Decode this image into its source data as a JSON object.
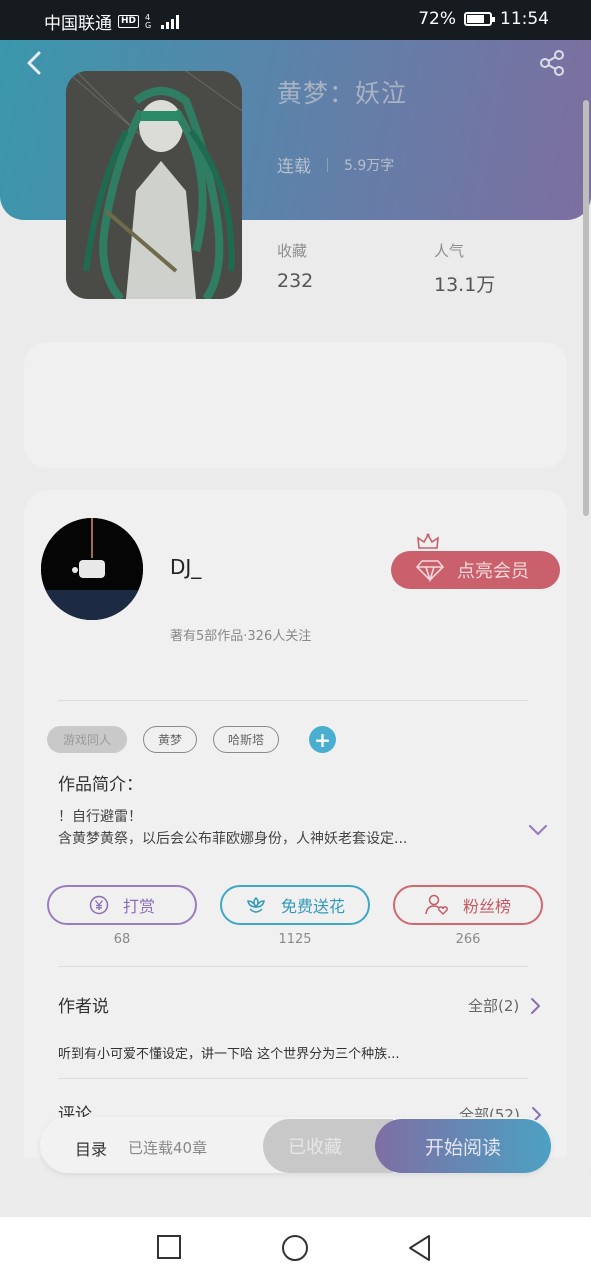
{
  "status": {
    "carrier": "中国联通",
    "hd": "HD",
    "network": "4G",
    "battery": "72%",
    "time": "11:54"
  },
  "book": {
    "title": "黄梦：妖泣",
    "status": "连载",
    "word_count": "5.9万字",
    "stats": [
      {
        "label": "收藏",
        "value": "232"
      },
      {
        "label": "人气",
        "value": "13.1万"
      }
    ]
  },
  "author": {
    "name": "DJ_",
    "vip_label": "点亮会员",
    "works_info": "著有5部作品·326人关注"
  },
  "tags": [
    "游戏同人",
    "黄梦",
    "哈斯塔"
  ],
  "intro": {
    "title": "作品简介：",
    "line1": "！自行避雷！",
    "line2": "含黄梦黄祭，以后会公布菲欧娜身份，人神妖老套设定..."
  },
  "actions": [
    {
      "label": "打赏",
      "count": "68",
      "icon": "yen-icon"
    },
    {
      "label": "免费送花",
      "count": "1125",
      "icon": "flower-icon"
    },
    {
      "label": "粉丝榜",
      "count": "266",
      "icon": "fan-icon"
    }
  ],
  "author_say": {
    "title": "作者说",
    "link": "全部(2)",
    "text": "听到有小可爱不懂设定，讲一下哈 这个世界分为三个种族..."
  },
  "comments": {
    "title": "评论",
    "link": "全部(52)"
  },
  "bottom": {
    "menu": "目录",
    "chapters": "已连载40章",
    "favorited": "已收藏",
    "read": "开始阅读"
  },
  "colors": {
    "header_start": "#3a97ac",
    "header_end": "#7d6e9f",
    "vip": "#c9606c",
    "accent": "#4aaed0"
  }
}
